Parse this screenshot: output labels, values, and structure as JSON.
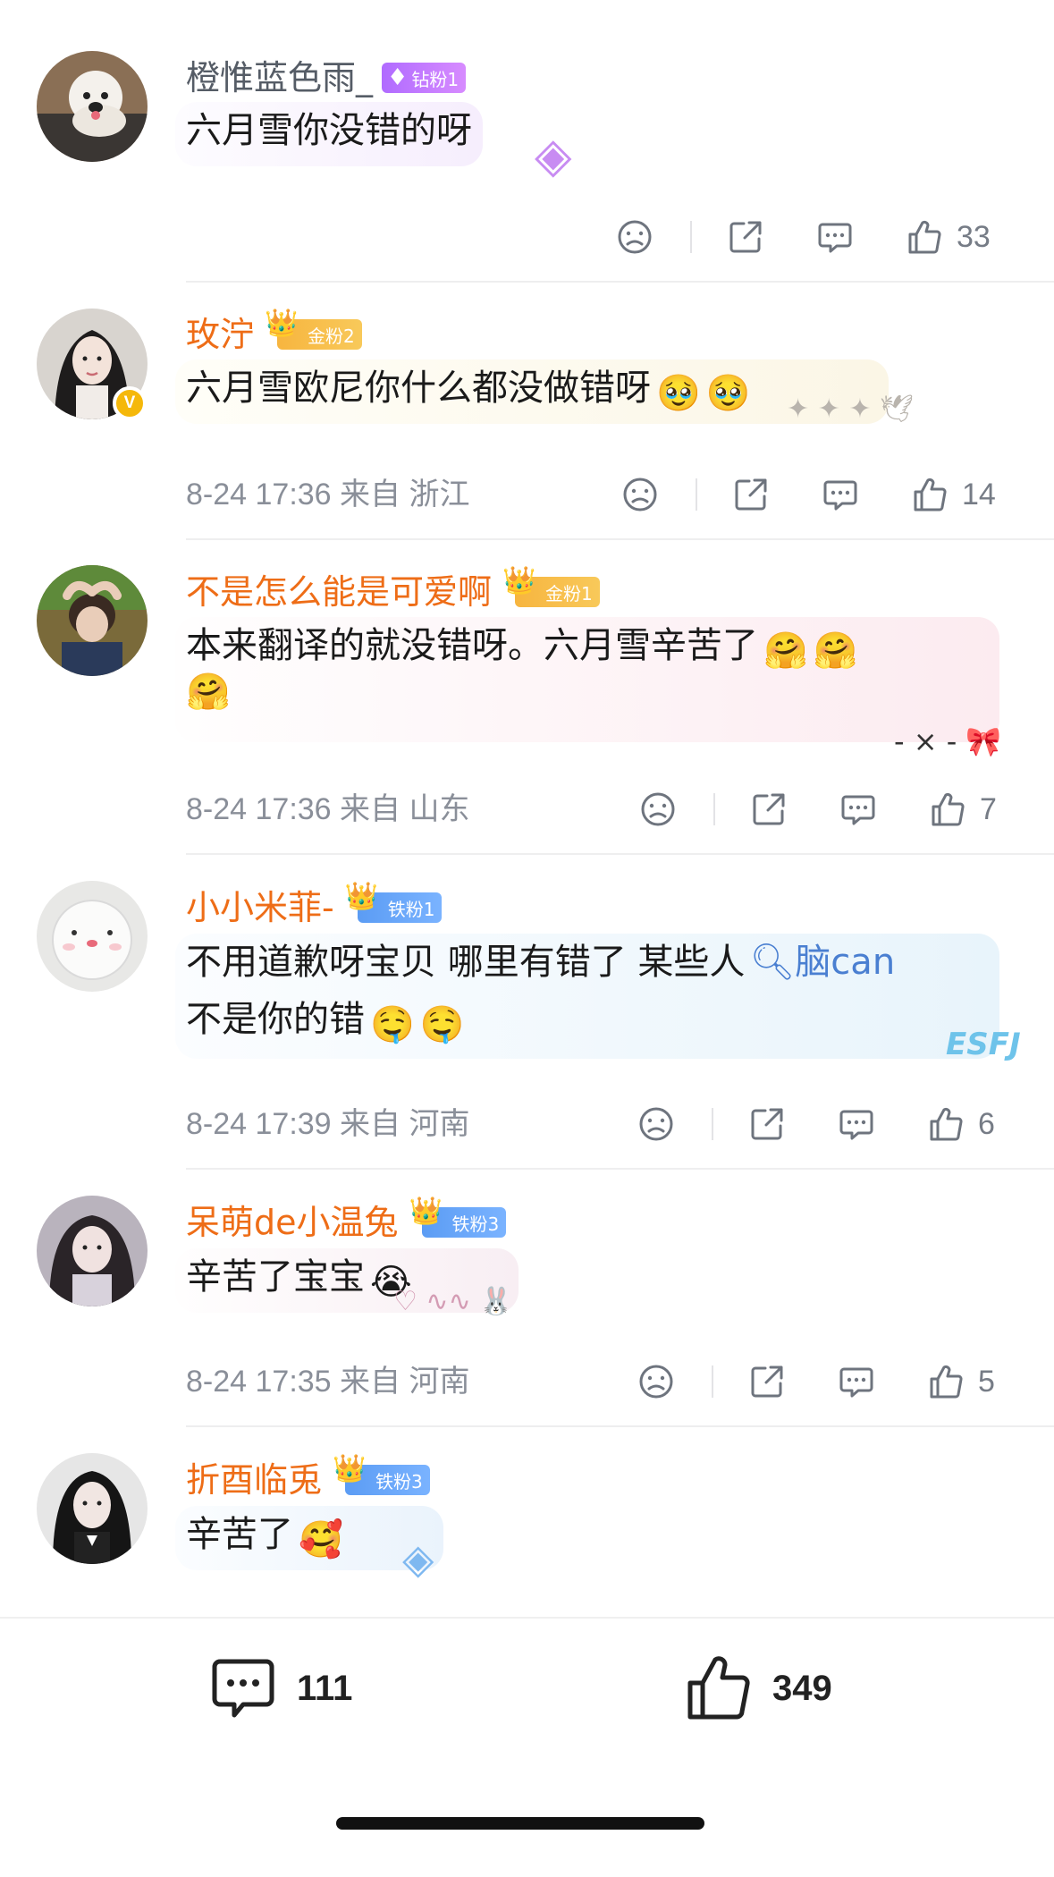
{
  "comments": [
    {
      "username": "橙惟蓝色雨_",
      "badge": "钻粉1",
      "text": "六月雪你没错的呀",
      "meta": "",
      "likes": "33"
    },
    {
      "username": "玫泞",
      "badge": "金粉2",
      "text": "六月雪欧尼你什么都没做错呀",
      "emojis": [
        "🥹",
        "🥹"
      ],
      "meta": "8-24 17:36 来自 浙江",
      "likes": "14"
    },
    {
      "username": "不是怎么能是可爱啊",
      "badge": "金粉1",
      "text": "本来翻译的就没错呀。六月雪辛苦了",
      "emojis": [
        "🤗",
        "🤗",
        "🤗"
      ],
      "meta": "8-24 17:36 来自 山东",
      "likes": "7"
    },
    {
      "username": "小小米菲-",
      "badge": "铁粉1",
      "text": "不用道歉呀宝贝 哪里有错了 某些人",
      "search_link": "脑can",
      "text2": "不是你的错",
      "emojis": [
        "🤤",
        "🤤"
      ],
      "deco": "ESFJ",
      "meta": "8-24 17:39 来自 河南",
      "likes": "6"
    },
    {
      "username": "呆萌de小温兔",
      "badge": "铁粉3",
      "text": "辛苦了宝宝",
      "emojis": [
        "😭"
      ],
      "meta": "8-24 17:35 来自 河南",
      "likes": "5"
    },
    {
      "username": "折酉临兎",
      "badge": "铁粉3",
      "text": "辛苦了",
      "emojis": [
        "🥰"
      ]
    }
  ],
  "bottom_bar": {
    "comments_count": "111",
    "likes_count": "349"
  },
  "colors": {
    "username_orange": "#ee6d17",
    "username_gray": "#555c66",
    "meta_gray": "#8a8f99"
  }
}
